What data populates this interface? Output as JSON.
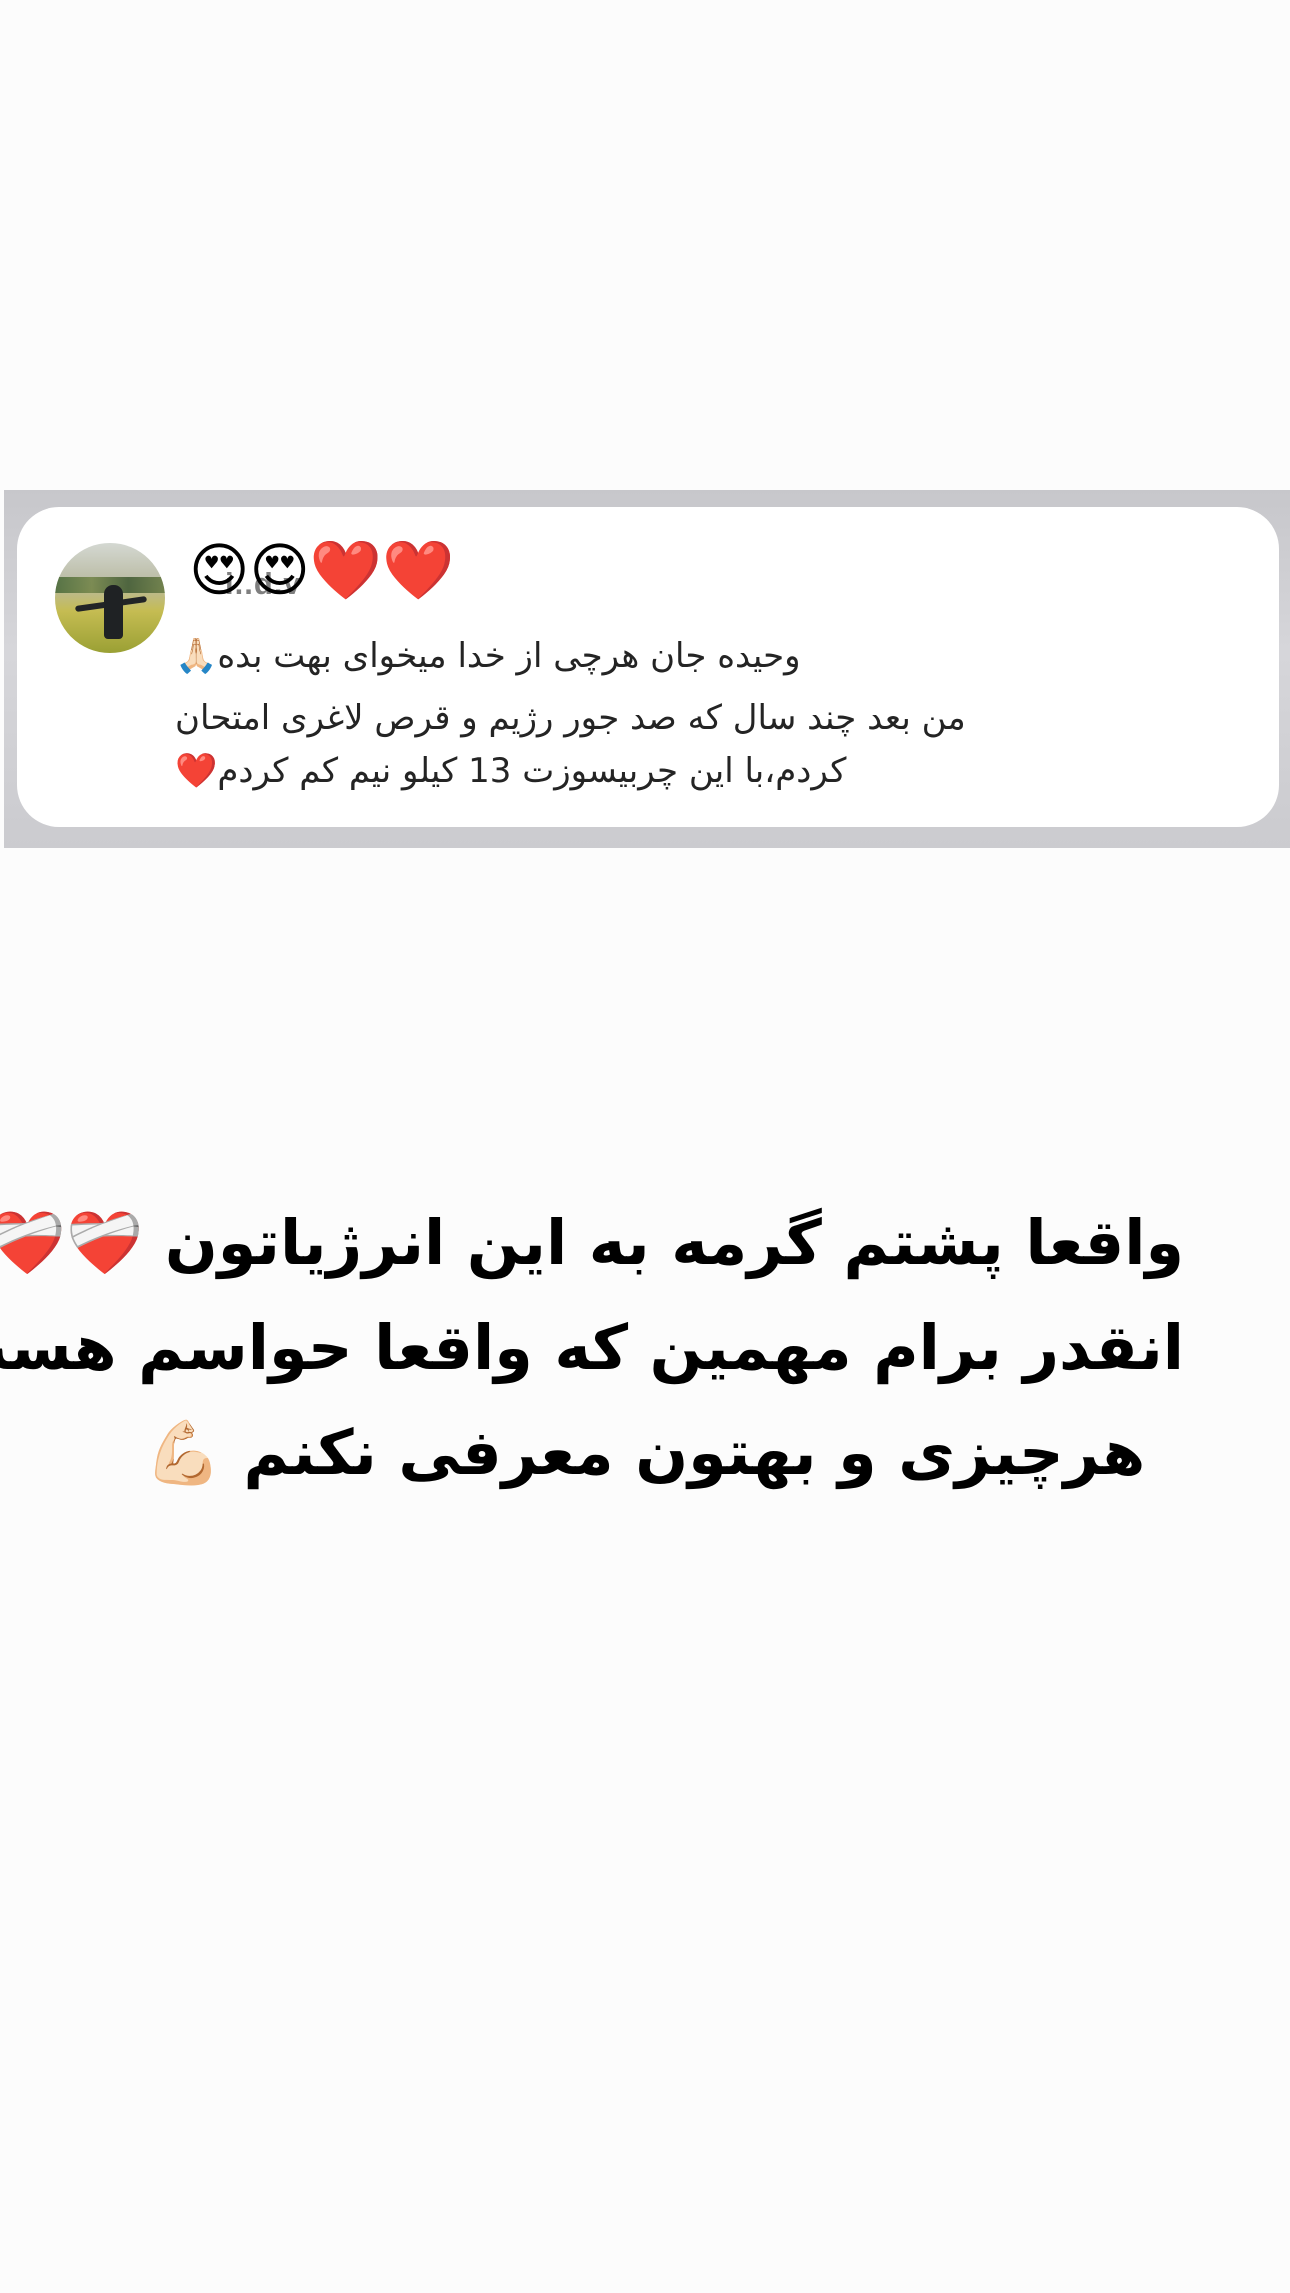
{
  "comment": {
    "username": "i..d.v",
    "emoji_title": "😍😍❤️❤️",
    "line1": "وحیده جان هرچی از خدا میخوای بهت بده🙏🏻",
    "line2": "من بعد چند سال که صد جور رژیم و قرص لاغری امتحان",
    "line3": "کردم،با این چربیسوزت 13 کیلو نیم کم کردم❤️"
  },
  "caption": {
    "line1": "واقعا پشتم گرمه به این انرژیاتون ❤️‍🩹❤️‍🩹",
    "line2": "انقدر برام مهمین که واقعا حواسم هست",
    "line3": "هرچیزی و بهتون معرفی نکنم 💪🏻"
  },
  "colors": {
    "background": "#fcfcfc",
    "comment_band": "#cbcbcf",
    "comment_card": "#ffffff",
    "comment_text": "#242424",
    "caption_text": "#000000"
  },
  "icons": {
    "avatar": "profile-photo",
    "emojis": [
      "heart-eyes",
      "red-heart",
      "praying-hands",
      "mending-heart",
      "flexed-biceps"
    ]
  }
}
